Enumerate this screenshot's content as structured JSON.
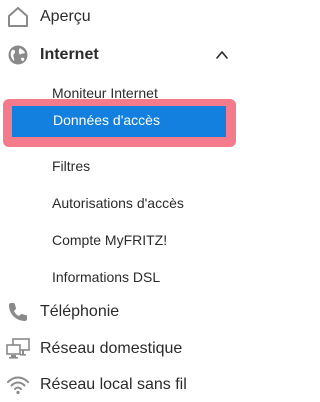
{
  "colors": {
    "accent_blue": "#1380df",
    "highlight_border": "#f47b8b",
    "icon_gray": "#8a8a8a",
    "text": "#2b2b2b"
  },
  "nav": {
    "apercu": {
      "label": "Aperçu",
      "icon": "home-icon"
    },
    "internet": {
      "label": "Internet",
      "icon": "globe-icon",
      "expanded": true,
      "items": [
        {
          "label": "Moniteur Internet"
        },
        {
          "label": "Données d'accès",
          "active": true
        },
        {
          "label": "Filtres"
        },
        {
          "label": "Autorisations d'accès"
        },
        {
          "label": "Compte MyFRITZ!"
        },
        {
          "label": "Informations DSL"
        }
      ]
    },
    "telephonie": {
      "label": "Téléphonie",
      "icon": "phone-icon"
    },
    "reseau_domestique": {
      "label": "Réseau domestique",
      "icon": "network-icon"
    },
    "wifi": {
      "label": "Réseau local sans fil",
      "icon": "wifi-icon"
    }
  }
}
